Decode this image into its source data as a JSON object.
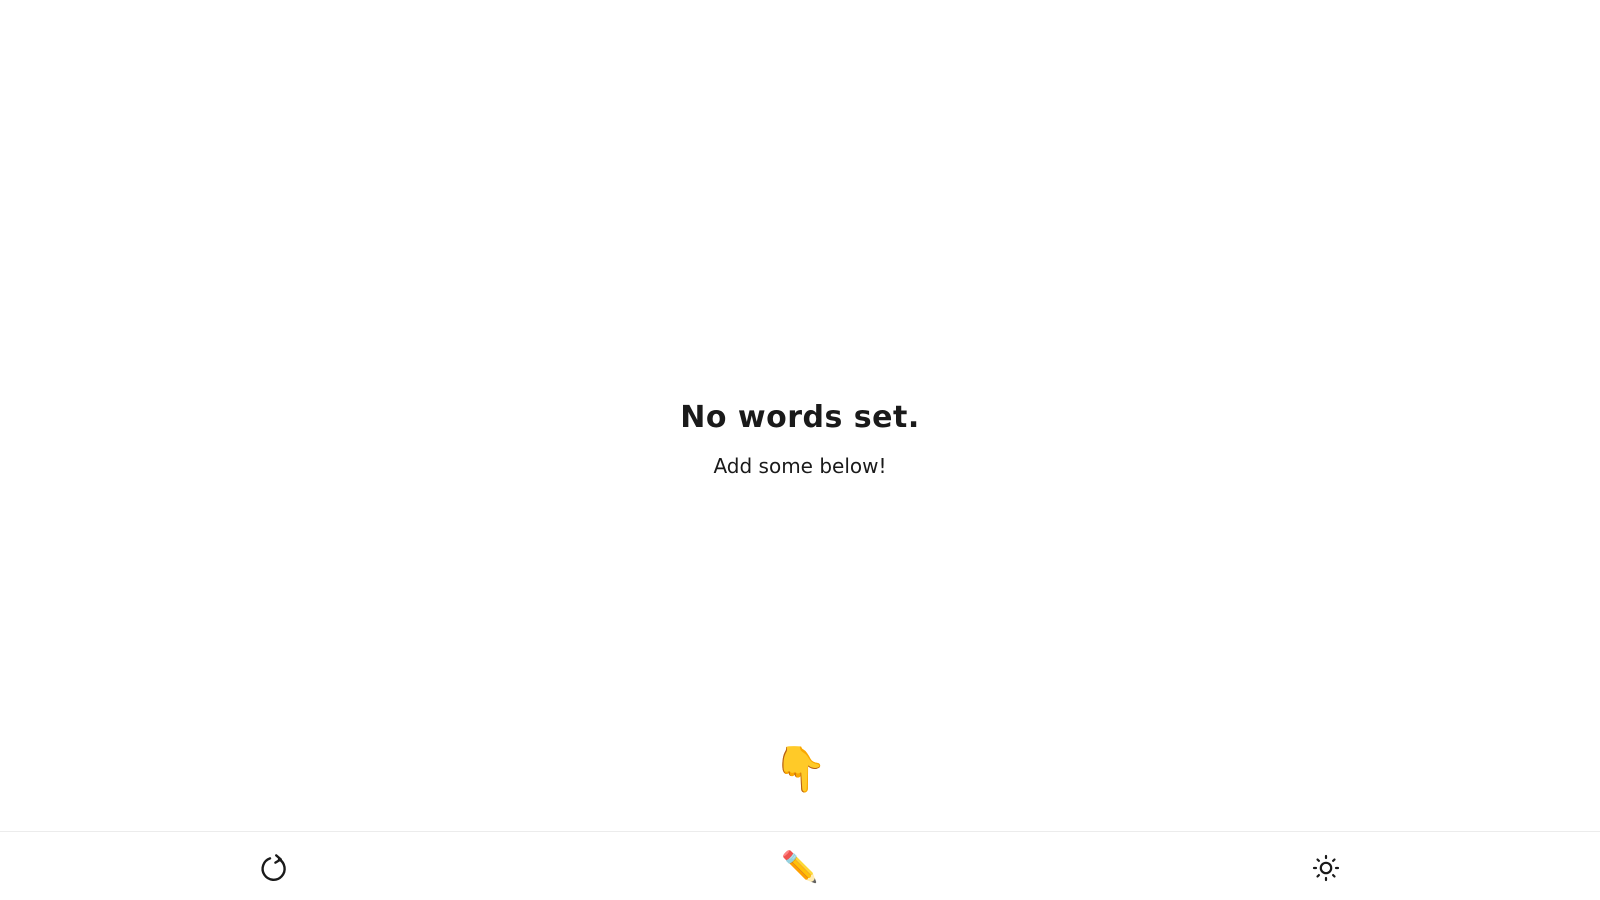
{
  "empty_state": {
    "title": "No words set.",
    "subtitle": "Add some below!",
    "pointer_icon": "pointing-down-hand-emoji"
  },
  "toolbar": {
    "reset_icon": "reload-icon",
    "edit_icon": "pencil-emoji",
    "theme_icon": "sun-icon"
  }
}
